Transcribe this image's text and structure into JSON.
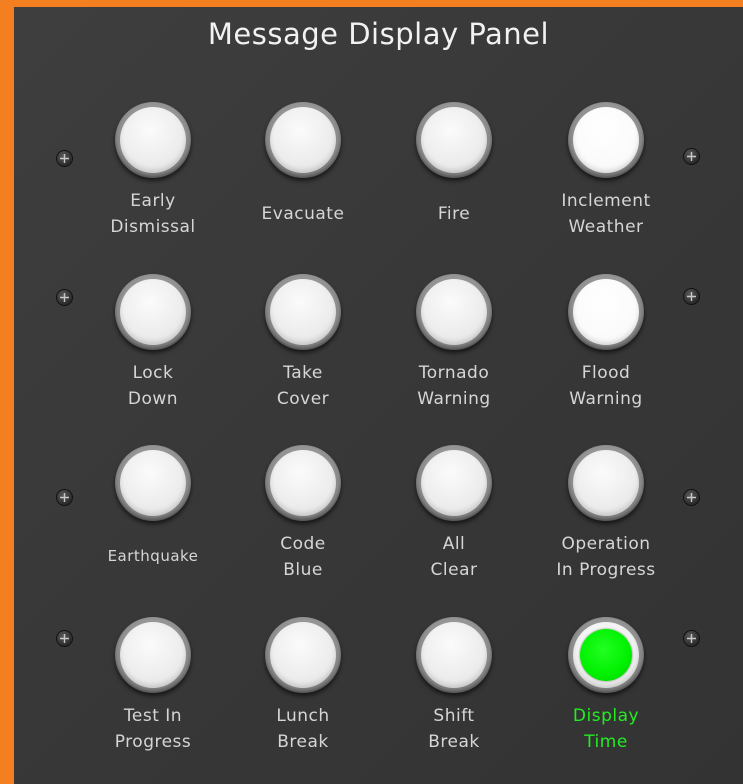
{
  "panel": {
    "title": "Message Display Panel",
    "background_color": "#3a3a3a",
    "frame_color": "#f47f20"
  },
  "buttons": [
    {
      "label": "Early\nDismissal",
      "lit": false
    },
    {
      "label": "Evacuate",
      "lit": false
    },
    {
      "label": "Fire",
      "lit": false
    },
    {
      "label": "Inclement\nWeather",
      "lit": false
    },
    {
      "label": "Lock\nDown",
      "lit": false
    },
    {
      "label": "Take\nCover",
      "lit": false
    },
    {
      "label": "Tornado\nWarning",
      "lit": false
    },
    {
      "label": "Flood\nWarning",
      "lit": false
    },
    {
      "label": "Earthquake",
      "lit": false
    },
    {
      "label": "Code\nBlue",
      "lit": false
    },
    {
      "label": "All\nClear",
      "lit": false
    },
    {
      "label": "Operation\nIn Progress",
      "lit": false
    },
    {
      "label": "Test In\nProgress",
      "lit": false
    },
    {
      "label": "Lunch\nBreak",
      "lit": false
    },
    {
      "label": "Shift\nBreak",
      "lit": false
    },
    {
      "label": "Display\nTime",
      "lit": true,
      "lit_color": "#00f000"
    }
  ],
  "screw_icon": "screw-icon"
}
